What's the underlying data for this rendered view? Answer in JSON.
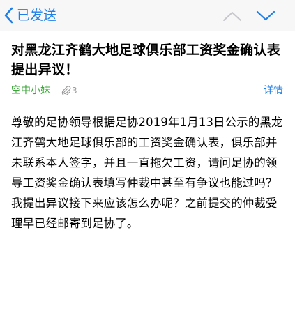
{
  "nav": {
    "back_label": "已发送",
    "back_icon": "chevron-left-icon",
    "prev_icon": "chevron-up-icon",
    "next_icon": "chevron-down-icon",
    "accent_color": "#1f7fe8",
    "disabled_color": "#c6c6cc"
  },
  "message": {
    "subject": "对黑龙江齐鹤大地足球俱乐部工资奖金确认表提出异议！",
    "sender": "空中小妹",
    "sender_color": "#3aa637",
    "attachment_count": "3",
    "details_label": "详情",
    "body": "尊敬的足协领导根据足协2019年1月13日公示的黑龙江齐鹤大地足球俱乐部的工资奖金确认表，俱乐部并未联系本人签字，并且一直拖欠工资，请问足协的领导工资奖金确认表填写仲裁中甚至有争议也能过吗？我提出异议接下来应该怎么办呢？之前提交的仲裁受理早已经邮寄到足协了。"
  }
}
